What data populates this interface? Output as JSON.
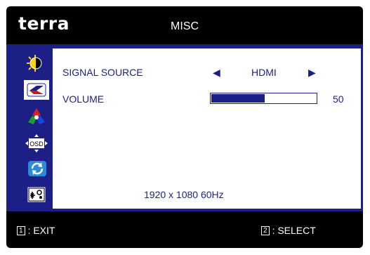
{
  "header": {
    "brand": "terra",
    "menu_title": "MISC"
  },
  "sidebar": {
    "items": [
      {
        "icon": "brightness-icon",
        "selected": false
      },
      {
        "icon": "image-settings-icon",
        "selected": true
      },
      {
        "icon": "color-icon",
        "selected": false
      },
      {
        "icon": "osd-settings-icon",
        "selected": false,
        "text": "OSD"
      },
      {
        "icon": "reset-icon",
        "selected": false
      },
      {
        "icon": "misc-icon",
        "selected": false
      }
    ]
  },
  "settings": {
    "signal_source": {
      "label": "SIGNAL SOURCE",
      "value": "HDMI",
      "left_arrow": "◀",
      "right_arrow": "▶"
    },
    "volume": {
      "label": "VOLUME",
      "value": "50",
      "level": 0.5
    }
  },
  "status": {
    "resolution": "1920 x 1080 60Hz"
  },
  "footer": {
    "exit": {
      "key": "1",
      "label": ": EXIT"
    },
    "select": {
      "key": "2",
      "label": ": SELECT"
    }
  },
  "colors": {
    "background": "#000000",
    "accent": "#1c1f86",
    "panel": "#ffffff"
  }
}
